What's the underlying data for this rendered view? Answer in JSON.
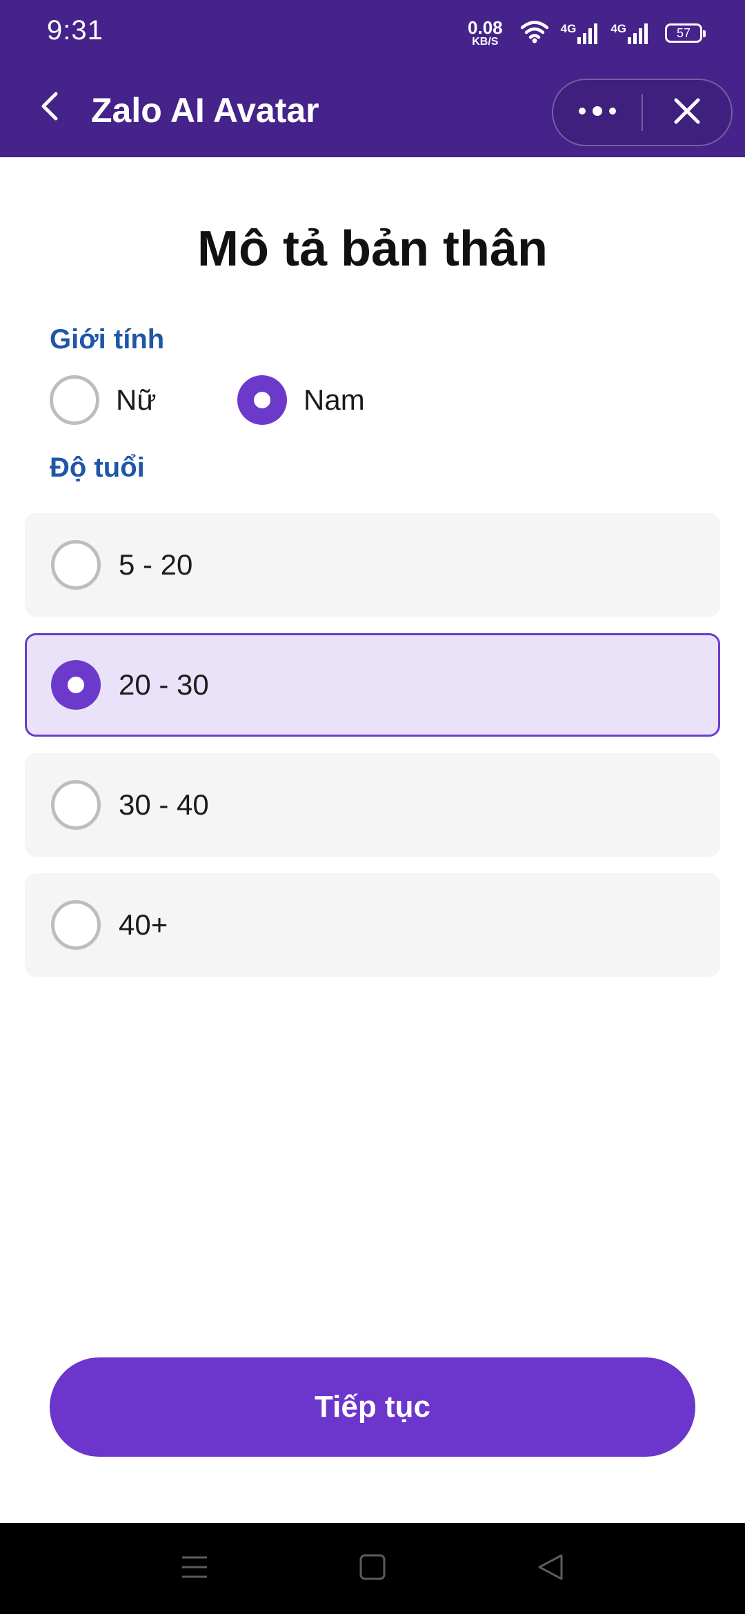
{
  "status_bar": {
    "time": "9:31",
    "net_speed_value": "0.08",
    "net_speed_unit": "KB/S",
    "signal_1_label": "4G",
    "signal_2_label": "4G",
    "battery_level": "57",
    "icons": [
      "wifi-icon",
      "signal-icon",
      "battery-icon"
    ]
  },
  "app_bar": {
    "title": "Zalo AI Avatar",
    "icons": [
      "back-icon",
      "more-icon",
      "close-icon"
    ],
    "background": "#45238a"
  },
  "main": {
    "title": "Mô tả bản thân",
    "gender": {
      "label": "Giới tính",
      "options": [
        {
          "label": "Nữ",
          "selected": false
        },
        {
          "label": "Nam",
          "selected": true
        }
      ]
    },
    "age": {
      "label": "Độ tuổi",
      "options": [
        {
          "label": "5 - 20",
          "selected": false
        },
        {
          "label": "20 - 30",
          "selected": true
        },
        {
          "label": "30 - 40",
          "selected": false
        },
        {
          "label": "40+",
          "selected": false
        }
      ]
    },
    "continue_label": "Tiếp tục"
  },
  "nav_bar": {
    "icons": [
      "menu-icon",
      "home-icon",
      "back-triangle-icon"
    ]
  },
  "colors": {
    "accent": "#6c36cc",
    "section_label": "#1f56a8",
    "selected_bg": "#eae2f8",
    "option_bg": "#f5f5f5"
  }
}
